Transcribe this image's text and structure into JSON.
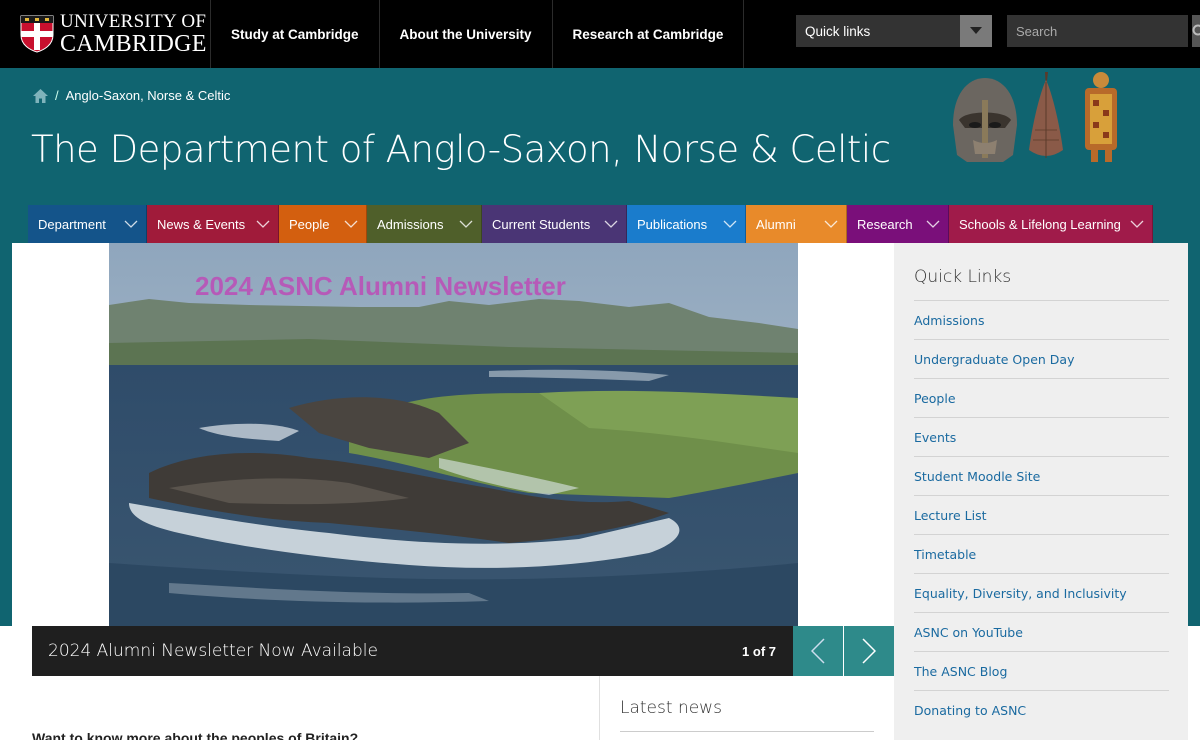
{
  "header": {
    "logo_line1": "UNIVERSITY OF",
    "logo_line2": "CAMBRIDGE",
    "nav": [
      "Study at Cambridge",
      "About the University",
      "Research at Cambridge"
    ],
    "quicklinks_label": "Quick links",
    "search_placeholder": "Search"
  },
  "banner": {
    "breadcrumb": "Anglo-Saxon, Norse & Celtic",
    "title": "The Department of Anglo-Saxon, Norse & Celtic"
  },
  "mainnav": {
    "tabs": [
      {
        "label": "Department",
        "color": "#14548a"
      },
      {
        "label": "News & Events",
        "color": "#a01b3a"
      },
      {
        "label": "People",
        "color": "#d35f0f"
      },
      {
        "label": "Admissions",
        "color": "#4f5f2a"
      },
      {
        "label": "Current Students",
        "color": "#4a3575"
      },
      {
        "label": "Publications",
        "color": "#1a7ccc"
      },
      {
        "label": "Alumni",
        "color": "#e88a2a"
      },
      {
        "label": "Research",
        "color": "#7a0f7a"
      },
      {
        "label": "Schools & Lifelong Learning",
        "color": "#a01b4a"
      }
    ]
  },
  "carousel": {
    "slide_title": "2024 ASNC Alumni Newsletter",
    "caption": "2024 Alumni Newsletter Now Available",
    "counter": "1 of 7"
  },
  "main": {
    "latest_news": "Latest news",
    "teaser": "Want to know more about the peoples of Britain?"
  },
  "sidebar": {
    "title": "Quick Links",
    "links": [
      "Admissions",
      "Undergraduate Open Day",
      "People",
      "Events",
      "Student Moodle Site",
      "Lecture List",
      "Timetable",
      "Equality, Diversity, and Inclusivity",
      "ASNC on YouTube",
      "The ASNC Blog",
      "Donating to ASNC"
    ]
  },
  "colors": {
    "teal": "#106470",
    "arrow_teal": "#2e8a8a",
    "link_blue": "#1a6aa0"
  }
}
